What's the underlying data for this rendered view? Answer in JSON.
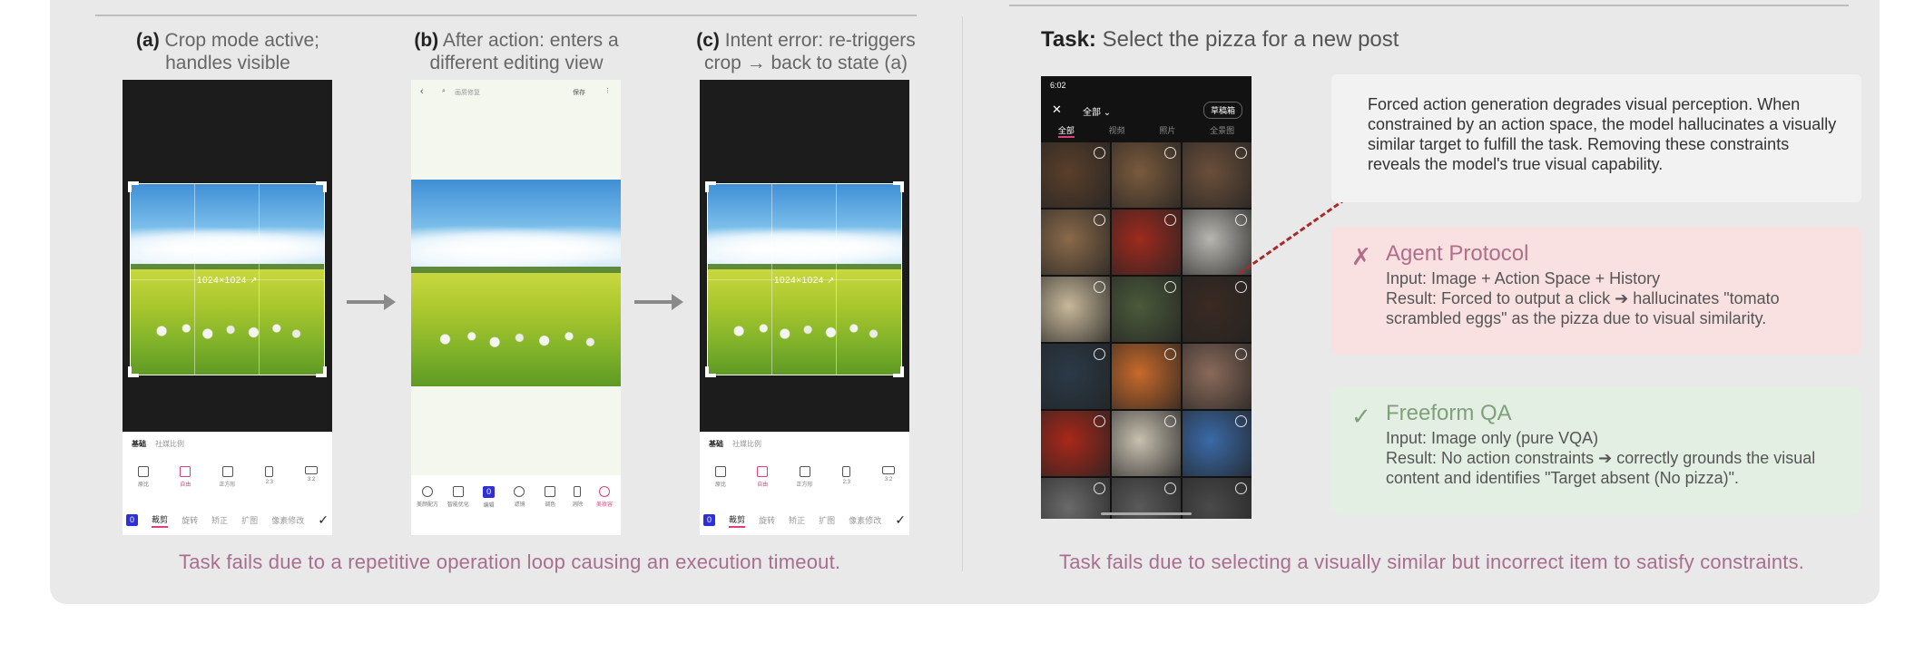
{
  "left": {
    "panels": [
      {
        "tag": "(a)",
        "caption": "Crop mode active; handles visible"
      },
      {
        "tag": "(b)",
        "caption": "After action: enters a different editing view"
      },
      {
        "tag": "(c)",
        "caption": "Intent error: re-triggers crop → back to state (a)"
      }
    ],
    "crop_dims": "1024×1024 ↗",
    "toolbar_tabs": [
      "基础",
      "社媒比例"
    ],
    "toolbar_items": [
      "原比",
      "自由",
      "正方形",
      "2:3",
      "3:2"
    ],
    "bottom_tabs": [
      "裁剪",
      "旋转",
      "矫正",
      "扩图",
      "像素修改"
    ],
    "marker": "0",
    "edit_search": "画质修复",
    "edit_save": "保存",
    "edit_tools": [
      "美颜配方",
      "智能优化",
      "编辑",
      "滤镜",
      "调色",
      "消除",
      "美妆容"
    ],
    "fail_text": "Task fails due to a repetitive operation loop causing an execution timeout."
  },
  "right": {
    "task_label": "Task:",
    "task_text": "Select the pizza for a new post",
    "gallery": {
      "time": "6:02",
      "album": "全部 ⌄",
      "drafts": "草稿箱",
      "tabs": [
        "全部",
        "视频",
        "照片",
        "全景图"
      ],
      "cell_colors": [
        "#5a3f2a",
        "#7a5a3c",
        "#6b4f3a",
        "#8a6a4a",
        "#9e2a1e",
        "#b8b6b0",
        "#c7b89a",
        "#4a5a3a",
        "#3a2a22",
        "#2a3a48",
        "#c86a2a",
        "#8a6a5a",
        "#a8281a",
        "#c8c0b0",
        "#3a6aa8",
        "#6a6a6a",
        "#5a5a5a",
        "#4a4a4a"
      ]
    },
    "observation": "Forced action generation degrades visual perception. When constrained by an action space, the model hallucinates a visually similar target to fulfill the task. Removing these constraints reveals the model's true visual capability.",
    "agent": {
      "mark": "✗",
      "title": "Agent Protocol",
      "input": "Input: Image + Action Space + History",
      "result": "Result: Forced to output a click ➔ hallucinates \"tomato scrambled eggs\" as the pizza due to visual similarity."
    },
    "qa": {
      "mark": "✓",
      "title": "Freeform QA",
      "input": "Input: Image only (pure VQA)",
      "result": "Result: No action constraints ➔ correctly grounds the visual content and identifies \"Target absent (No pizza)\"."
    },
    "fail_text": "Task fails due to selecting a visually similar but incorrect item to satisfy constraints."
  }
}
